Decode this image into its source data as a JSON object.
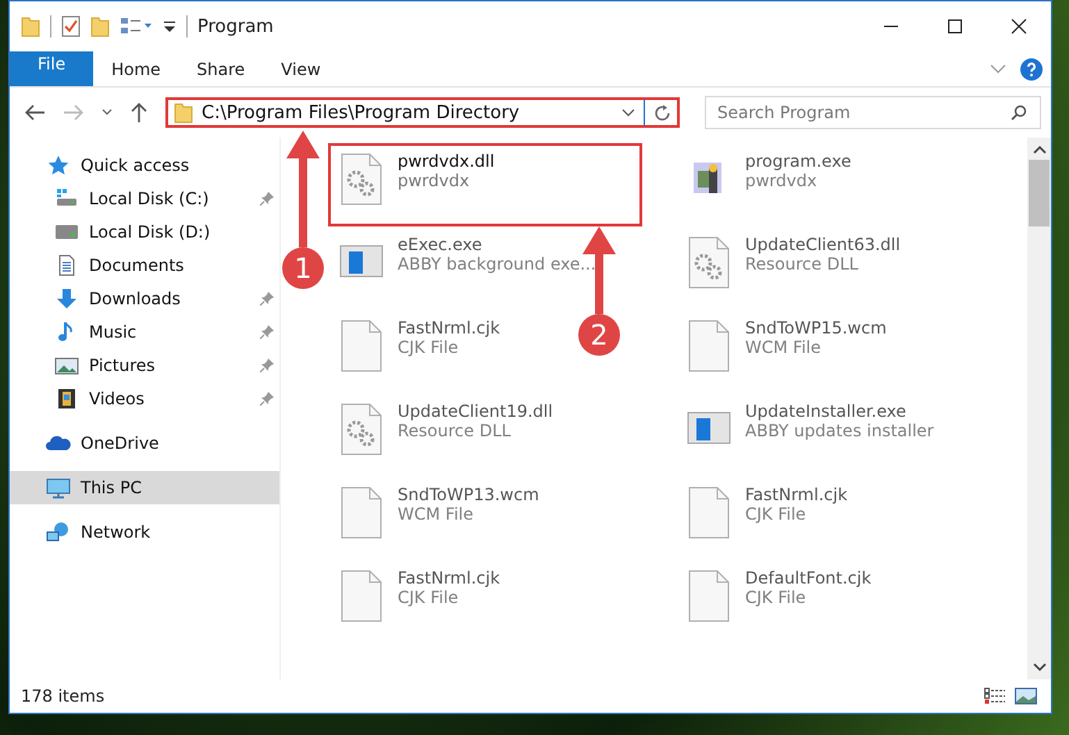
{
  "window": {
    "title": "Program"
  },
  "ribbon_tabs": [
    {
      "label": "File",
      "selected": true
    },
    {
      "label": "Home",
      "selected": false
    },
    {
      "label": "Share",
      "selected": false
    },
    {
      "label": "View",
      "selected": false
    }
  ],
  "address_bar": {
    "path": "C:\\Program Files\\Program Directory"
  },
  "search": {
    "placeholder": "Search Program"
  },
  "sidebar": {
    "items": [
      {
        "label": "Quick access",
        "kind": "star",
        "selected": false,
        "children": [
          {
            "label": "Local Disk (C:)",
            "kind": "diskc",
            "pinned": true
          },
          {
            "label": "Local Disk (D:)",
            "kind": "disk",
            "pinned": false
          },
          {
            "label": "Documents",
            "kind": "docs",
            "pinned": false
          },
          {
            "label": "Downloads",
            "kind": "down",
            "pinned": true
          },
          {
            "label": "Music",
            "kind": "music",
            "pinned": true
          },
          {
            "label": "Pictures",
            "kind": "pics",
            "pinned": true
          },
          {
            "label": "Videos",
            "kind": "video",
            "pinned": true
          }
        ]
      },
      {
        "label": "OneDrive",
        "kind": "cloud",
        "selected": false
      },
      {
        "label": "This PC",
        "kind": "pc",
        "selected": true
      },
      {
        "label": "Network",
        "kind": "net",
        "selected": false
      }
    ]
  },
  "files": [
    {
      "name": "pwrdvdx.dll",
      "detail": "pwrdvdx",
      "kind": "gear",
      "highlighted": true
    },
    {
      "name": "program.exe",
      "detail": "pwrdvdx",
      "kind": "app",
      "highlighted": false
    },
    {
      "name": "eExec.exe",
      "detail": "ABBY background exe...",
      "kind": "window",
      "highlighted": false
    },
    {
      "name": "UpdateClient63.dll",
      "detail": "Resource DLL",
      "kind": "gear",
      "highlighted": false
    },
    {
      "name": "FastNrml.cjk",
      "detail": "CJK File",
      "kind": "blank",
      "highlighted": false
    },
    {
      "name": "SndToWP15.wcm",
      "detail": "WCM File",
      "kind": "blank",
      "highlighted": false
    },
    {
      "name": "UpdateClient19.dll",
      "detail": "Resource DLL",
      "kind": "gear",
      "highlighted": false
    },
    {
      "name": "UpdateInstaller.exe",
      "detail": "ABBY updates installer",
      "kind": "window",
      "highlighted": false
    },
    {
      "name": "SndToWP13.wcm",
      "detail": "WCM File",
      "kind": "blank",
      "highlighted": false
    },
    {
      "name": "FastNrml.cjk",
      "detail": "CJK File",
      "kind": "blank",
      "highlighted": false
    },
    {
      "name": "FastNrml.cjk",
      "detail": "CJK File",
      "kind": "blank",
      "highlighted": false
    },
    {
      "name": "DefaultFont.cjk",
      "detail": "CJK File",
      "kind": "blank",
      "highlighted": false
    }
  ],
  "callouts": [
    {
      "number": "1"
    },
    {
      "number": "2"
    }
  ],
  "status_bar": {
    "item_count": "178 items"
  }
}
